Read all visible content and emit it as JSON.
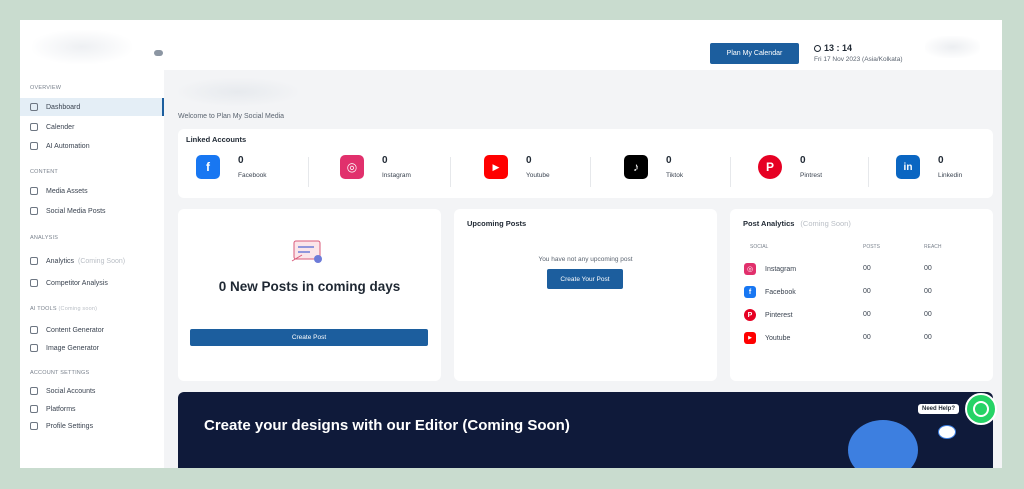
{
  "header": {
    "plan_button": "Plan My Calendar",
    "time": "13 : 14",
    "date": "Fri 17 Nov 2023 (Asia/Kolkata)"
  },
  "sidebar": {
    "overview_title": "OVERVIEW",
    "content_title": "CONTENT",
    "analysis_title": "ANALYSIS",
    "ai_tools_title": "AI TOOLS",
    "ai_tools_soon": "(Coming soon)",
    "account_title": "ACCOUNT SETTINGS",
    "items": [
      {
        "label": "Dashboard",
        "icon": "dashboard-icon"
      },
      {
        "label": "Calender",
        "icon": "calendar-icon"
      },
      {
        "label": "AI Automation",
        "icon": "robot-icon"
      },
      {
        "label": "Media Assets",
        "icon": "media-icon"
      },
      {
        "label": "Social Media Posts",
        "icon": "posts-icon"
      },
      {
        "label": "Analytics",
        "icon": "analytics-icon",
        "soon": "(Coming Soon)"
      },
      {
        "label": "Competitor Analysis",
        "icon": "competitor-icon"
      },
      {
        "label": "Content Generator",
        "icon": "content-generator-icon"
      },
      {
        "label": "Image Generator",
        "icon": "image-icon"
      },
      {
        "label": "Social Accounts",
        "icon": "link-icon"
      },
      {
        "label": "Platforms",
        "icon": "platforms-icon"
      },
      {
        "label": "Profile Settings",
        "icon": "user-icon"
      }
    ]
  },
  "main": {
    "welcome": "Welcome to Plan My Social Media",
    "linked_title": "Linked Accounts",
    "accounts": [
      {
        "name": "Facebook",
        "count": "0",
        "color": "#1877f2",
        "glyph": "f"
      },
      {
        "name": "Instagram",
        "count": "0",
        "color": "#e1306c",
        "glyph": "◎"
      },
      {
        "name": "Youtube",
        "count": "0",
        "color": "#ff0000",
        "glyph": "▶"
      },
      {
        "name": "Tiktok",
        "count": "0",
        "color": "#000000",
        "glyph": "♪"
      },
      {
        "name": "Pintrest",
        "count": "0",
        "color": "#e60023",
        "glyph": "P"
      },
      {
        "name": "Linkedin",
        "count": "0",
        "color": "#0a66c2",
        "glyph": "in"
      }
    ],
    "new_posts_title": "0 New Posts in coming days",
    "create_post_button": "Create Post",
    "upcoming_title": "Upcoming Posts",
    "upcoming_empty": "You have not any upcoming post",
    "create_your_post_button": "Create Your Post",
    "analytics_title": "Post Analytics",
    "analytics_soon": "(Coming Soon)",
    "analytics_headers": [
      "SOCIAL",
      "POSTS",
      "REACH"
    ],
    "analytics_rows": [
      {
        "social": "Instagram",
        "posts": "00",
        "reach": "00",
        "color": "#e1306c",
        "glyph": "◎"
      },
      {
        "social": "Facebook",
        "posts": "00",
        "reach": "00",
        "color": "#1877f2",
        "glyph": "f"
      },
      {
        "social": "Pinterest",
        "posts": "00",
        "reach": "00",
        "color": "#e60023",
        "glyph": "P"
      },
      {
        "social": "Youtube",
        "posts": "00",
        "reach": "00",
        "color": "#ff0000",
        "glyph": "▶"
      }
    ],
    "banner_title": "Create your designs with our Editor (Coming Soon)",
    "need_help": "Need Help?"
  },
  "colors": {
    "primary": "#1c5e9e",
    "banner_bg": "#0f1a3a",
    "whatsapp": "#25d366"
  }
}
